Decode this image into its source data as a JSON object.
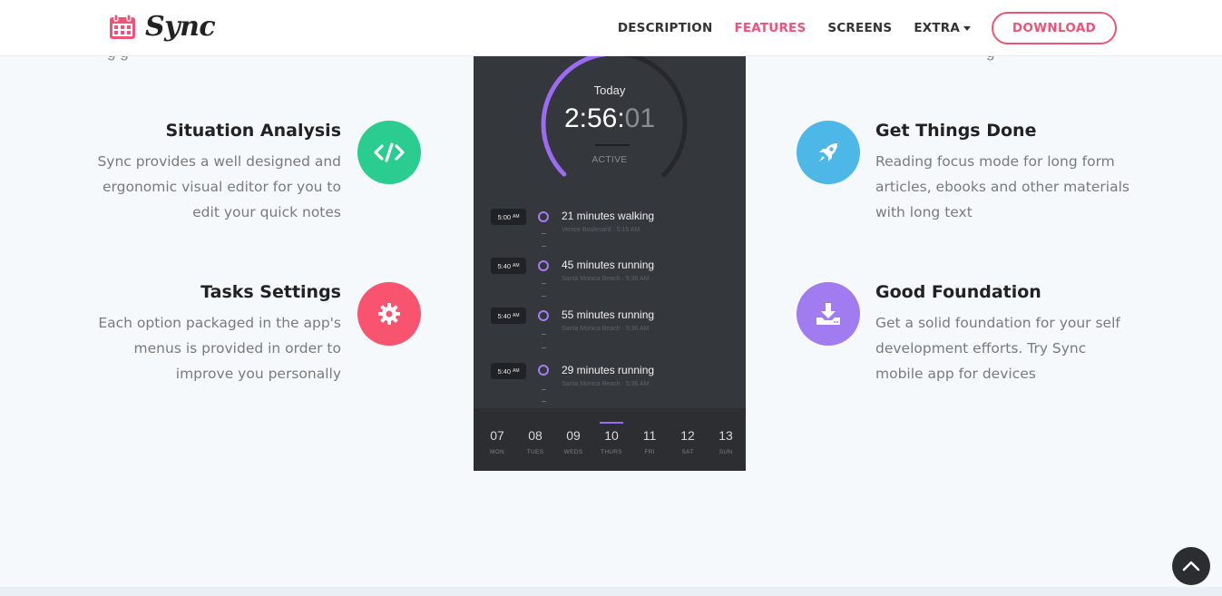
{
  "brand": {
    "name": "Sync",
    "color": "#f25278"
  },
  "nav": {
    "items": [
      {
        "label": "DESCRIPTION",
        "active": false
      },
      {
        "label": "FEATURES",
        "active": true
      },
      {
        "label": "SCREENS",
        "active": false
      },
      {
        "label": "EXTRA",
        "active": false
      }
    ],
    "download_label": "DOWNLOAD"
  },
  "features": {
    "left": [
      {
        "title": "Situation Analysis",
        "text": "Sync provides a well designed and ergonomic visual editor for you to edit your quick notes",
        "icon": "code-icon",
        "color": "#2bcc8f"
      },
      {
        "title": "Tasks Settings",
        "text": "Each option packaged in the app's menus is provided in order to improve you personally",
        "icon": "gear-icon",
        "color": "#f8546f"
      }
    ],
    "right": [
      {
        "title": "Get Things Done",
        "text": "Reading focus mode for long form articles, ebooks and other materials with long text",
        "icon": "rocket-icon",
        "color": "#4db7e8"
      },
      {
        "title": "Good Foundation",
        "text": "Get a solid foundation for your self development efforts. Try Sync mobile app for devices",
        "icon": "download-icon",
        "color": "#a17bf0"
      }
    ]
  },
  "phone": {
    "today_label": "Today",
    "clock_main": "2:56:",
    "clock_secs": "01",
    "status": "ACTIVE",
    "activities": [
      {
        "time": "5:00",
        "ampm": "AM",
        "title": "21 minutes walking",
        "place": "Venice Boulevard · 5:15 AM"
      },
      {
        "time": "5:40",
        "ampm": "AM",
        "title": "45 minutes running",
        "place": "Santa Monica Beach · 5:36 AM"
      },
      {
        "time": "5:40",
        "ampm": "AM",
        "title": "55 minutes running",
        "place": "Santa Monica Beach · 5:36 AM"
      },
      {
        "time": "5:40",
        "ampm": "AM",
        "title": "29 minutes running",
        "place": "Santa Monica Beach · 5:36 AM"
      }
    ],
    "days": [
      {
        "num": "07",
        "name": "MON",
        "selected": false
      },
      {
        "num": "08",
        "name": "TUES",
        "selected": false
      },
      {
        "num": "09",
        "name": "WEDS",
        "selected": false
      },
      {
        "num": "10",
        "name": "THURS",
        "selected": true
      },
      {
        "num": "11",
        "name": "FRI",
        "selected": false
      },
      {
        "num": "12",
        "name": "SAT",
        "selected": false
      },
      {
        "num": "13",
        "name": "SUN",
        "selected": false
      }
    ]
  },
  "cut_text": {
    "left": "g                         g",
    "right": "g"
  }
}
